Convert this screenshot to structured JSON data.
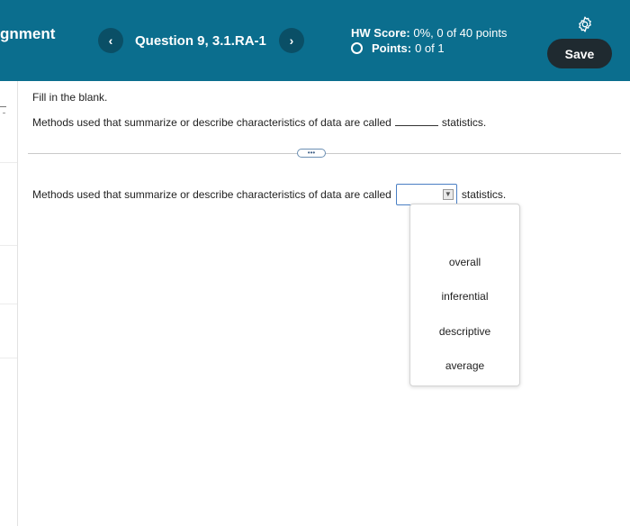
{
  "header": {
    "assignment_title": "gnment",
    "question_label": "Question 9, 3.1.RA-1",
    "prev_symbol": "‹",
    "next_symbol": "›",
    "hw_score_label": "HW Score:",
    "hw_score_value": "0%, 0 of 40 points",
    "points_label": "Points:",
    "points_value": "0 of 1",
    "save_label": "Save",
    "settings_icon": "gear-icon",
    "colors": {
      "bar": "#0b6e8e",
      "nav_button": "#0a4f66",
      "save_button": "#1f2a30"
    }
  },
  "question": {
    "instruction": "Fill in the blank.",
    "text_before": "Methods used that summarize or describe characteristics of data are called",
    "text_after": "statistics."
  },
  "expander_label": "•••",
  "answer": {
    "text_before": "Methods used that summarize or describe characteristics of data are called",
    "text_after": "statistics.",
    "selected_value": "",
    "dropdown_arrow": "▼"
  },
  "dropdown": {
    "options": [
      "overall",
      "inferential",
      "descriptive",
      "average"
    ]
  }
}
